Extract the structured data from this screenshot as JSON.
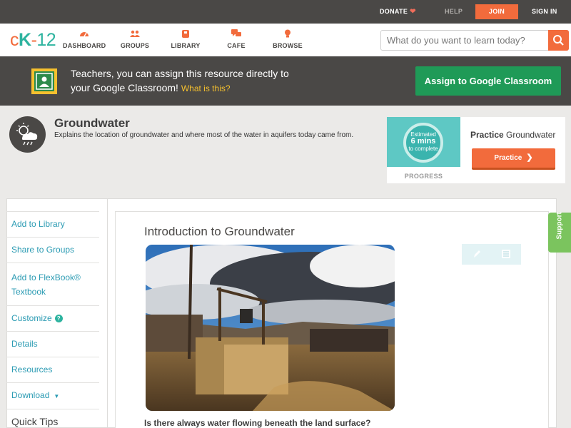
{
  "topbar": {
    "donate_label": "DONATE",
    "help_label": "HELP",
    "join_label": "JOIN",
    "signin_label": "SIGN IN"
  },
  "logo": {
    "c": "c",
    "k": "K",
    "dash": "-",
    "num": "12"
  },
  "nav": {
    "items": [
      {
        "label": "DASHBOARD",
        "icon": "dashboard-icon"
      },
      {
        "label": "GROUPS",
        "icon": "groups-icon"
      },
      {
        "label": "LIBRARY",
        "icon": "library-icon"
      },
      {
        "label": "CAFE",
        "icon": "cafe-icon"
      },
      {
        "label": "BROWSE",
        "icon": "browse-icon"
      }
    ],
    "search_placeholder": "What do you want to learn today?"
  },
  "banner": {
    "line1": "Teachers, you can assign this resource directly to",
    "line2": "your Google Classroom!",
    "what_link": "What is this?",
    "assign_label": "Assign to Google Classroom"
  },
  "concept": {
    "title": "Groundwater",
    "description": "Explains the location of groundwater and where most of the water in aquifers today came from."
  },
  "practice": {
    "est_line1": "Estimated",
    "est_mins": "6 mins",
    "est_line3": "to complete",
    "progress_label": "PROGRESS",
    "title_bold": "Practice",
    "title_rest": "Groundwater",
    "button_label": "Practice"
  },
  "sidebar": {
    "add_library": "Add to Library",
    "share_groups": "Share to Groups",
    "add_flexbook_1": "Add to FlexBook®",
    "add_flexbook_2": "Textbook",
    "customize": "Customize",
    "customize_help": "?",
    "details": "Details",
    "resources": "Resources",
    "download": "Download",
    "quick_tips": "Quick Tips"
  },
  "reader": {
    "title": "Introduction to Groundwater",
    "question": "Is there always water flowing beneath the land surface?"
  },
  "support_label": "Support",
  "colors": {
    "brand_orange": "#f26b3c",
    "brand_teal": "#2db39f",
    "classroom_green": "#1f9a57",
    "dark_bar": "#4a4846",
    "link_blue": "#2b9bb3",
    "support_green": "#7bc45e"
  }
}
